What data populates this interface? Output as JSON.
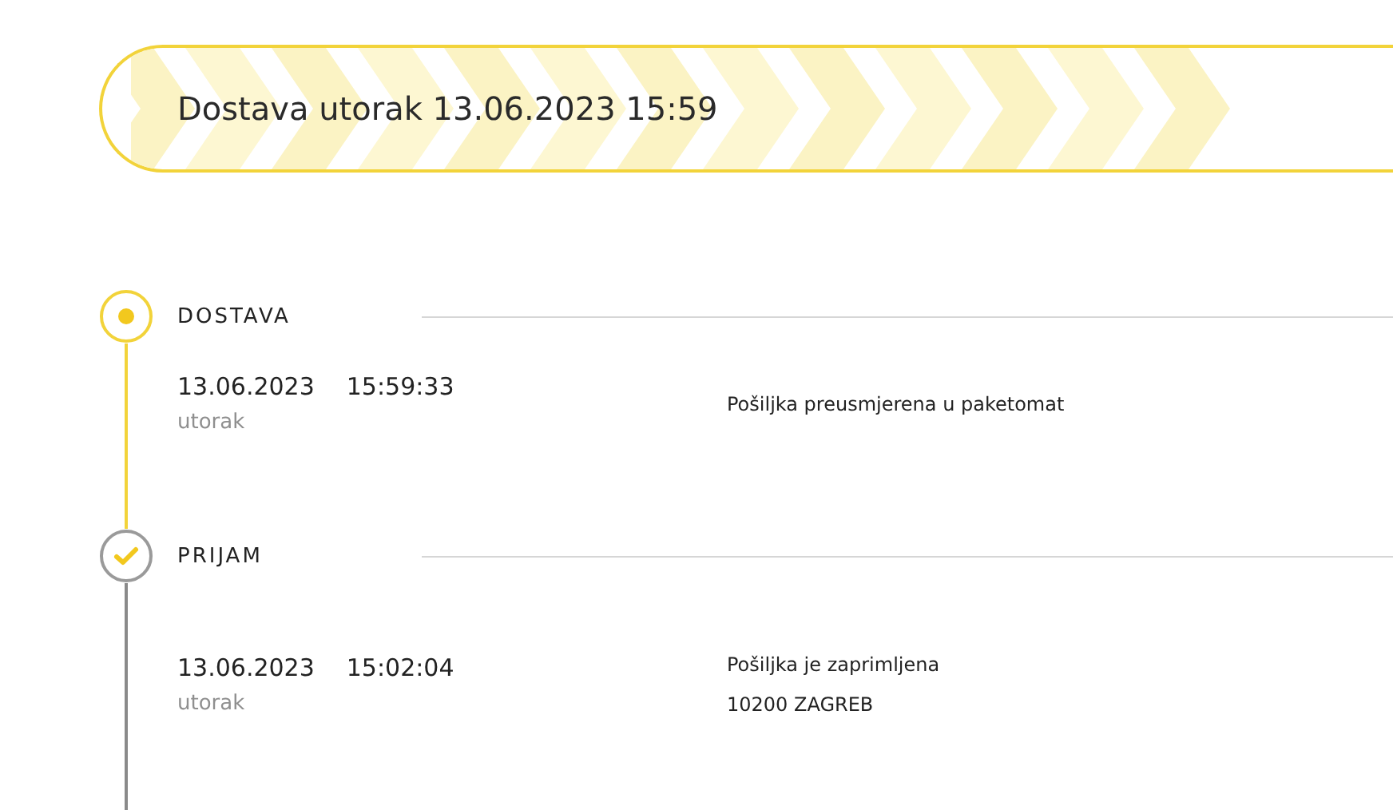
{
  "banner": {
    "title": "Dostava utorak 13.06.2023 15:59"
  },
  "events": [
    {
      "kind": "current",
      "label": "DOSTAVA",
      "date": "13.06.2023",
      "time": "15:59:33",
      "weekday": "utorak",
      "details": [
        "Pošiljka preusmjerena u paketomat"
      ]
    },
    {
      "kind": "done",
      "label": "PRIJAM",
      "date": "13.06.2023",
      "time": "15:02:04",
      "weekday": "utorak",
      "details": [
        "Pošiljka je zaprimljena",
        "10200 ZAGREB"
      ]
    }
  ]
}
